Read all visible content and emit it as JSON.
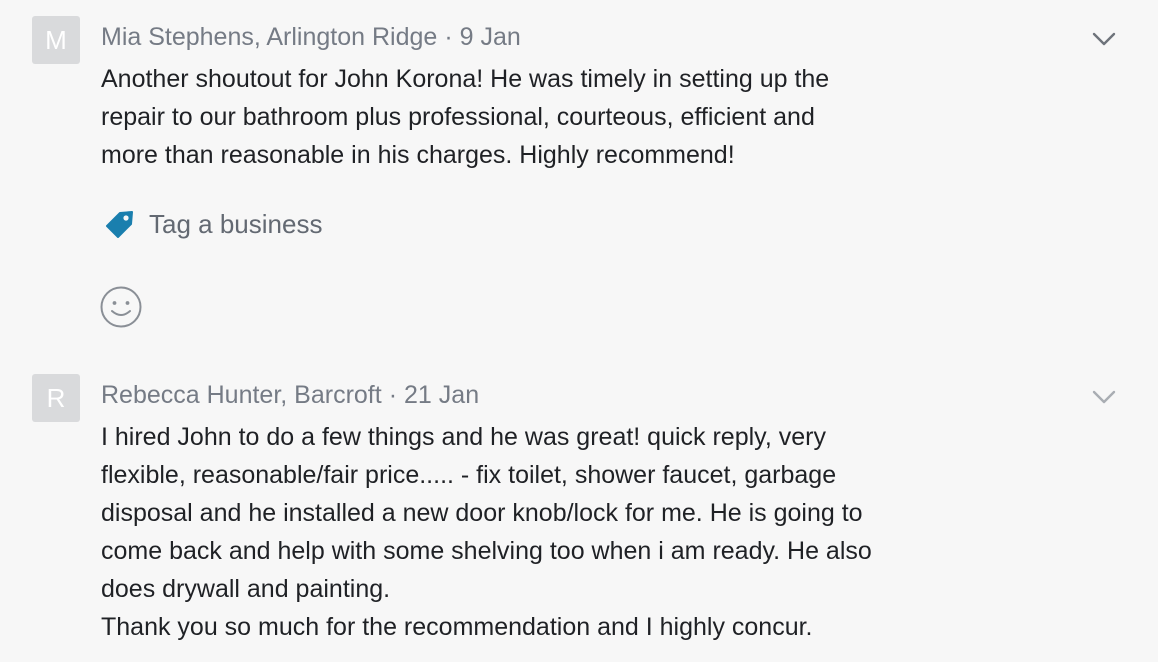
{
  "comments": [
    {
      "avatar_initial": "M",
      "author": "Mia Stephens, Arlington Ridge",
      "separator": "·",
      "date": "9 Jan",
      "lines": [
        "Another shoutout for John Korona!  He was timely in setting up the",
        "repair to our bathroom plus professional, courteous, efficient and",
        "more than reasonable in his charges.  Highly recommend!"
      ],
      "tag_label": "Tag a business",
      "chevron_icon": "chevron-down-icon",
      "reaction_icon": "smiley-icon"
    },
    {
      "avatar_initial": "R",
      "author": "Rebecca Hunter, Barcroft",
      "separator": "·",
      "date": "21 Jan",
      "lines": [
        "I hired John to do a few things and he was great!  quick reply, very",
        "flexible, reasonable/fair price..... - fix toilet, shower faucet, garbage",
        "disposal and he installed a new door knob/lock for me.  He is going to",
        "come back and help with some shelving too when i am ready.  He also",
        "does drywall and painting.",
        "Thank you so much for the recommendation and I highly concur."
      ],
      "chevron_icon": "chevron-down-icon"
    }
  ],
  "colors": {
    "background": "#f7f7f7",
    "avatar": "#d9dadc",
    "meta_text": "#757b85",
    "body_text": "#1f2125",
    "tag_icon": "#1a7fae",
    "chevron": "#6e737b",
    "chevron_muted": "#a9adb3"
  }
}
